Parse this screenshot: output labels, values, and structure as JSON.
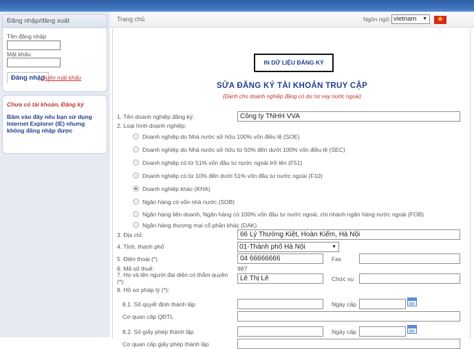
{
  "sidebar": {
    "login_title": "Đăng nhập/đăng xuất",
    "username_label": "Tên đăng nhập",
    "password_label": "Mật khẩu",
    "login_button": "Đăng nhập",
    "forgot_link": "Quên mật khẩu",
    "no_account_text": "Chưa có tài khoản, Đăng ký",
    "ie_notice": "Bấm vào đây nếu bạn sử dụng Internet Explorer (IE) nhưng không đăng nhập được"
  },
  "header": {
    "breadcrumb": "Trang chủ",
    "language_label": "Ngôn ngữ:",
    "language_value": "vietnam"
  },
  "form": {
    "print_button": "IN DỮ LIỆU ĐĂNG KÝ",
    "title": "SỬA ĐĂNG KÝ TÀI KHOẢN TRUY CẬP",
    "subtitle": "(Dành cho doanh nghiệp đăng có dư nợ vay nước ngoài)",
    "company_name_label": "1. Tên doanh nghiệp đăng ký:",
    "company_name_value": "Công ty TNHH VVA",
    "company_type_label": "2. Loại hình doanh nghiệp:",
    "company_types": [
      "Doanh nghiệp do Nhà nước sở hữu 100% vốn điều lệ (SOE)",
      "Doanh nghiệp do Nhà nước sở hữu từ 50% đến dưới 100% vốn điều lệ (SEC)",
      "Doanh nghiệp có từ 51% vốn đầu tư nước ngoài trở lên (F51)",
      "Doanh nghiệp có từ 10% đến dưới 51% vốn đầu tư nước ngoài (F10)",
      "Doanh nghiệp khác (KHA)",
      "Ngân hàng có vốn nhà nước (SOB)",
      "Ngân hàng liên doanh, Ngân hàng có 100% vốn đầu tư nước ngoài, chi nhánh ngân hàng nước ngoài (FOB)",
      "Ngân hàng thương mại cổ phần khác (DAK)"
    ],
    "selected_company_type": "Doanh nghiệp khác (KHA)",
    "address_label": "3. Địa chỉ:",
    "address_value": "66 Lý Thường Kiệt, Hoàn Kiếm, Hà Nội",
    "province_label": "4. Tỉnh, thành phố",
    "province_value": "01-Thành phố Hà Nội",
    "phone_label": "5. Điện thoại (*)",
    "phone_value": "04 66666666",
    "fax_label": "Fax",
    "fax_value": "",
    "tax_code_label": "6. Mã số thuế:",
    "tax_code_value": "987",
    "representative_label": "7. Họ và tên người đại diện có thẩm quyền (*):",
    "representative_value": "Lê Thị Lê",
    "position_label": "Chức vụ",
    "position_value": "",
    "legal_docs_label": "8. Hồ sơ pháp lý (*):",
    "decision_number_label": "8.1. Số quyết định thành lập",
    "decision_issue_date_label": "Ngày cấp",
    "decision_authority_label": "Cơ quan cấp QĐTL",
    "license_number_label": "8.2. Số giấy phép thành lập",
    "license_issue_date_label": "Ngày cấp",
    "license_authority_label": "Cơ quan cấp giấy phép thành lập"
  },
  "colors": {
    "accent": "#1f3f8f",
    "warning_red": "#c0332f",
    "topbar_blue": "#3e74bf"
  }
}
